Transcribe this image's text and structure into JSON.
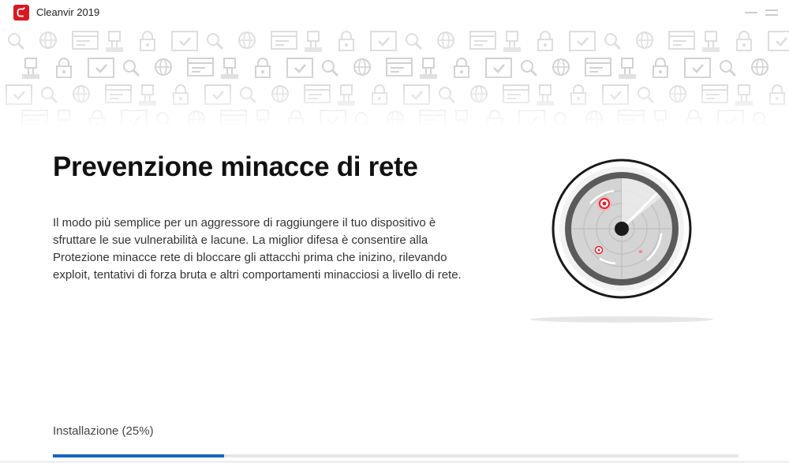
{
  "window": {
    "title": "Cleanvir 2019",
    "logo_icon": "cleanvir-logo-icon",
    "minimize_icon": "minimize-icon",
    "maximize_icon": "maximize-icon"
  },
  "banner": {
    "pattern_icons": [
      "magnifier-icon",
      "globe-icon",
      "browser-window-icon",
      "network-plug-icon",
      "padlock-icon",
      "checkmark-window-icon"
    ]
  },
  "main": {
    "heading": "Prevenzione minacce di rete",
    "description": "Il modo più semplice per un aggressore di raggiungere il tuo dispositivo è sfruttare le sue vulnerabilità e lacune. La miglior difesa è consentire alla Protezione minacce rete di bloccare gli attacchi prima che inizino, rilevando exploit, tentativi di forza bruta e altri comportamenti minacciosi a livello di rete.",
    "illustration_icon": "radar-icon"
  },
  "progress": {
    "label": "Installazione (25%)",
    "value": 0.25
  },
  "colors": {
    "accent": "#1665c1",
    "brand": "#d71920",
    "track": "#e6e6e6"
  }
}
